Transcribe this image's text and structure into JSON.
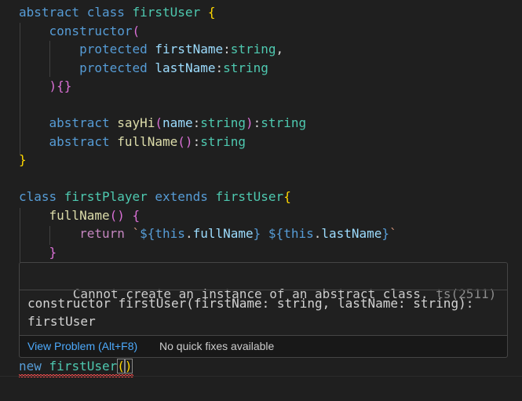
{
  "code": {
    "lines": [
      {
        "tokens": [
          {
            "t": "abstract class ",
            "c": "kw"
          },
          {
            "t": "firstUser",
            "c": "cls"
          },
          {
            "t": " ",
            "c": "plain"
          },
          {
            "t": "{",
            "c": "b1"
          }
        ]
      },
      {
        "tokens": [
          {
            "t": "    ",
            "c": "plain"
          },
          {
            "t": "constructor",
            "c": "kw"
          },
          {
            "t": "(",
            "c": "b2"
          }
        ]
      },
      {
        "tokens": [
          {
            "t": "        ",
            "c": "plain"
          },
          {
            "t": "protected",
            "c": "kw"
          },
          {
            "t": " ",
            "c": "plain"
          },
          {
            "t": "firstName",
            "c": "prop"
          },
          {
            "t": ":",
            "c": "plain"
          },
          {
            "t": "string",
            "c": "cls"
          },
          {
            "t": ",",
            "c": "plain"
          }
        ]
      },
      {
        "tokens": [
          {
            "t": "        ",
            "c": "plain"
          },
          {
            "t": "protected",
            "c": "kw"
          },
          {
            "t": " ",
            "c": "plain"
          },
          {
            "t": "lastName",
            "c": "prop"
          },
          {
            "t": ":",
            "c": "plain"
          },
          {
            "t": "string",
            "c": "cls"
          }
        ]
      },
      {
        "tokens": [
          {
            "t": "    ",
            "c": "plain"
          },
          {
            "t": ")",
            "c": "b2"
          },
          {
            "t": "{}",
            "c": "b2"
          }
        ]
      },
      {
        "tokens": []
      },
      {
        "tokens": [
          {
            "t": "    ",
            "c": "plain"
          },
          {
            "t": "abstract",
            "c": "kw"
          },
          {
            "t": " ",
            "c": "plain"
          },
          {
            "t": "sayHi",
            "c": "fn"
          },
          {
            "t": "(",
            "c": "b2"
          },
          {
            "t": "name",
            "c": "prop"
          },
          {
            "t": ":",
            "c": "plain"
          },
          {
            "t": "string",
            "c": "cls"
          },
          {
            "t": ")",
            "c": "b2"
          },
          {
            "t": ":",
            "c": "plain"
          },
          {
            "t": "string",
            "c": "cls"
          }
        ]
      },
      {
        "tokens": [
          {
            "t": "    ",
            "c": "plain"
          },
          {
            "t": "abstract",
            "c": "kw"
          },
          {
            "t": " ",
            "c": "plain"
          },
          {
            "t": "fullName",
            "c": "fn"
          },
          {
            "t": "()",
            "c": "b2"
          },
          {
            "t": ":",
            "c": "plain"
          },
          {
            "t": "string",
            "c": "cls"
          }
        ]
      },
      {
        "tokens": [
          {
            "t": "}",
            "c": "b1"
          }
        ]
      },
      {
        "tokens": []
      },
      {
        "tokens": [
          {
            "t": "class ",
            "c": "kw"
          },
          {
            "t": "firstPlayer",
            "c": "cls"
          },
          {
            "t": " ",
            "c": "plain"
          },
          {
            "t": "extends",
            "c": "kw"
          },
          {
            "t": " ",
            "c": "plain"
          },
          {
            "t": "firstUser",
            "c": "cls"
          },
          {
            "t": "{",
            "c": "b1"
          }
        ]
      },
      {
        "tokens": [
          {
            "t": "    ",
            "c": "plain"
          },
          {
            "t": "fullName",
            "c": "fn"
          },
          {
            "t": "()",
            "c": "b2"
          },
          {
            "t": " ",
            "c": "plain"
          },
          {
            "t": "{",
            "c": "b2"
          }
        ]
      },
      {
        "tokens": [
          {
            "t": "        ",
            "c": "plain"
          },
          {
            "t": "return",
            "c": "ctrl"
          },
          {
            "t": " ",
            "c": "plain"
          },
          {
            "t": "`",
            "c": "str"
          },
          {
            "t": "${",
            "c": "kw"
          },
          {
            "t": "this",
            "c": "kw"
          },
          {
            "t": ".",
            "c": "plain"
          },
          {
            "t": "fullName",
            "c": "prop"
          },
          {
            "t": "}",
            "c": "kw"
          },
          {
            "t": " ",
            "c": "str"
          },
          {
            "t": "${",
            "c": "kw"
          },
          {
            "t": "this",
            "c": "kw"
          },
          {
            "t": ".",
            "c": "plain"
          },
          {
            "t": "lastName",
            "c": "prop"
          },
          {
            "t": "}",
            "c": "kw"
          },
          {
            "t": "`",
            "c": "str"
          }
        ]
      },
      {
        "tokens": [
          {
            "t": "    ",
            "c": "plain"
          },
          {
            "t": "}",
            "c": "b2"
          }
        ]
      }
    ],
    "last_line": [
      {
        "t": "new",
        "c": "kw"
      },
      {
        "t": " ",
        "c": "plain"
      },
      {
        "t": "firstUser",
        "c": "cls"
      },
      {
        "t": "(",
        "c": "b1 match"
      },
      {
        "t": ")",
        "c": "b1 match"
      }
    ]
  },
  "hover": {
    "message": "Cannot create an instance of an abstract class.",
    "source": "ts(2511)",
    "signature_line1": "constructor firstUser(firstName: string, lastName: string):",
    "signature_line2": "firstUser",
    "view_problem": "View Problem (Alt+F8)",
    "no_fixes": "No quick fixes available"
  },
  "colors": {
    "background": "#1f1f1f",
    "keyword": "#569cd6",
    "class_name": "#4ec9b0",
    "function": "#dcdcaa",
    "property": "#9cdcfe",
    "control": "#c586c0",
    "bracket_level1": "#ffd700",
    "bracket_level2": "#da70d6",
    "error_squiggle": "#f14c4c",
    "link": "#4daafc"
  }
}
